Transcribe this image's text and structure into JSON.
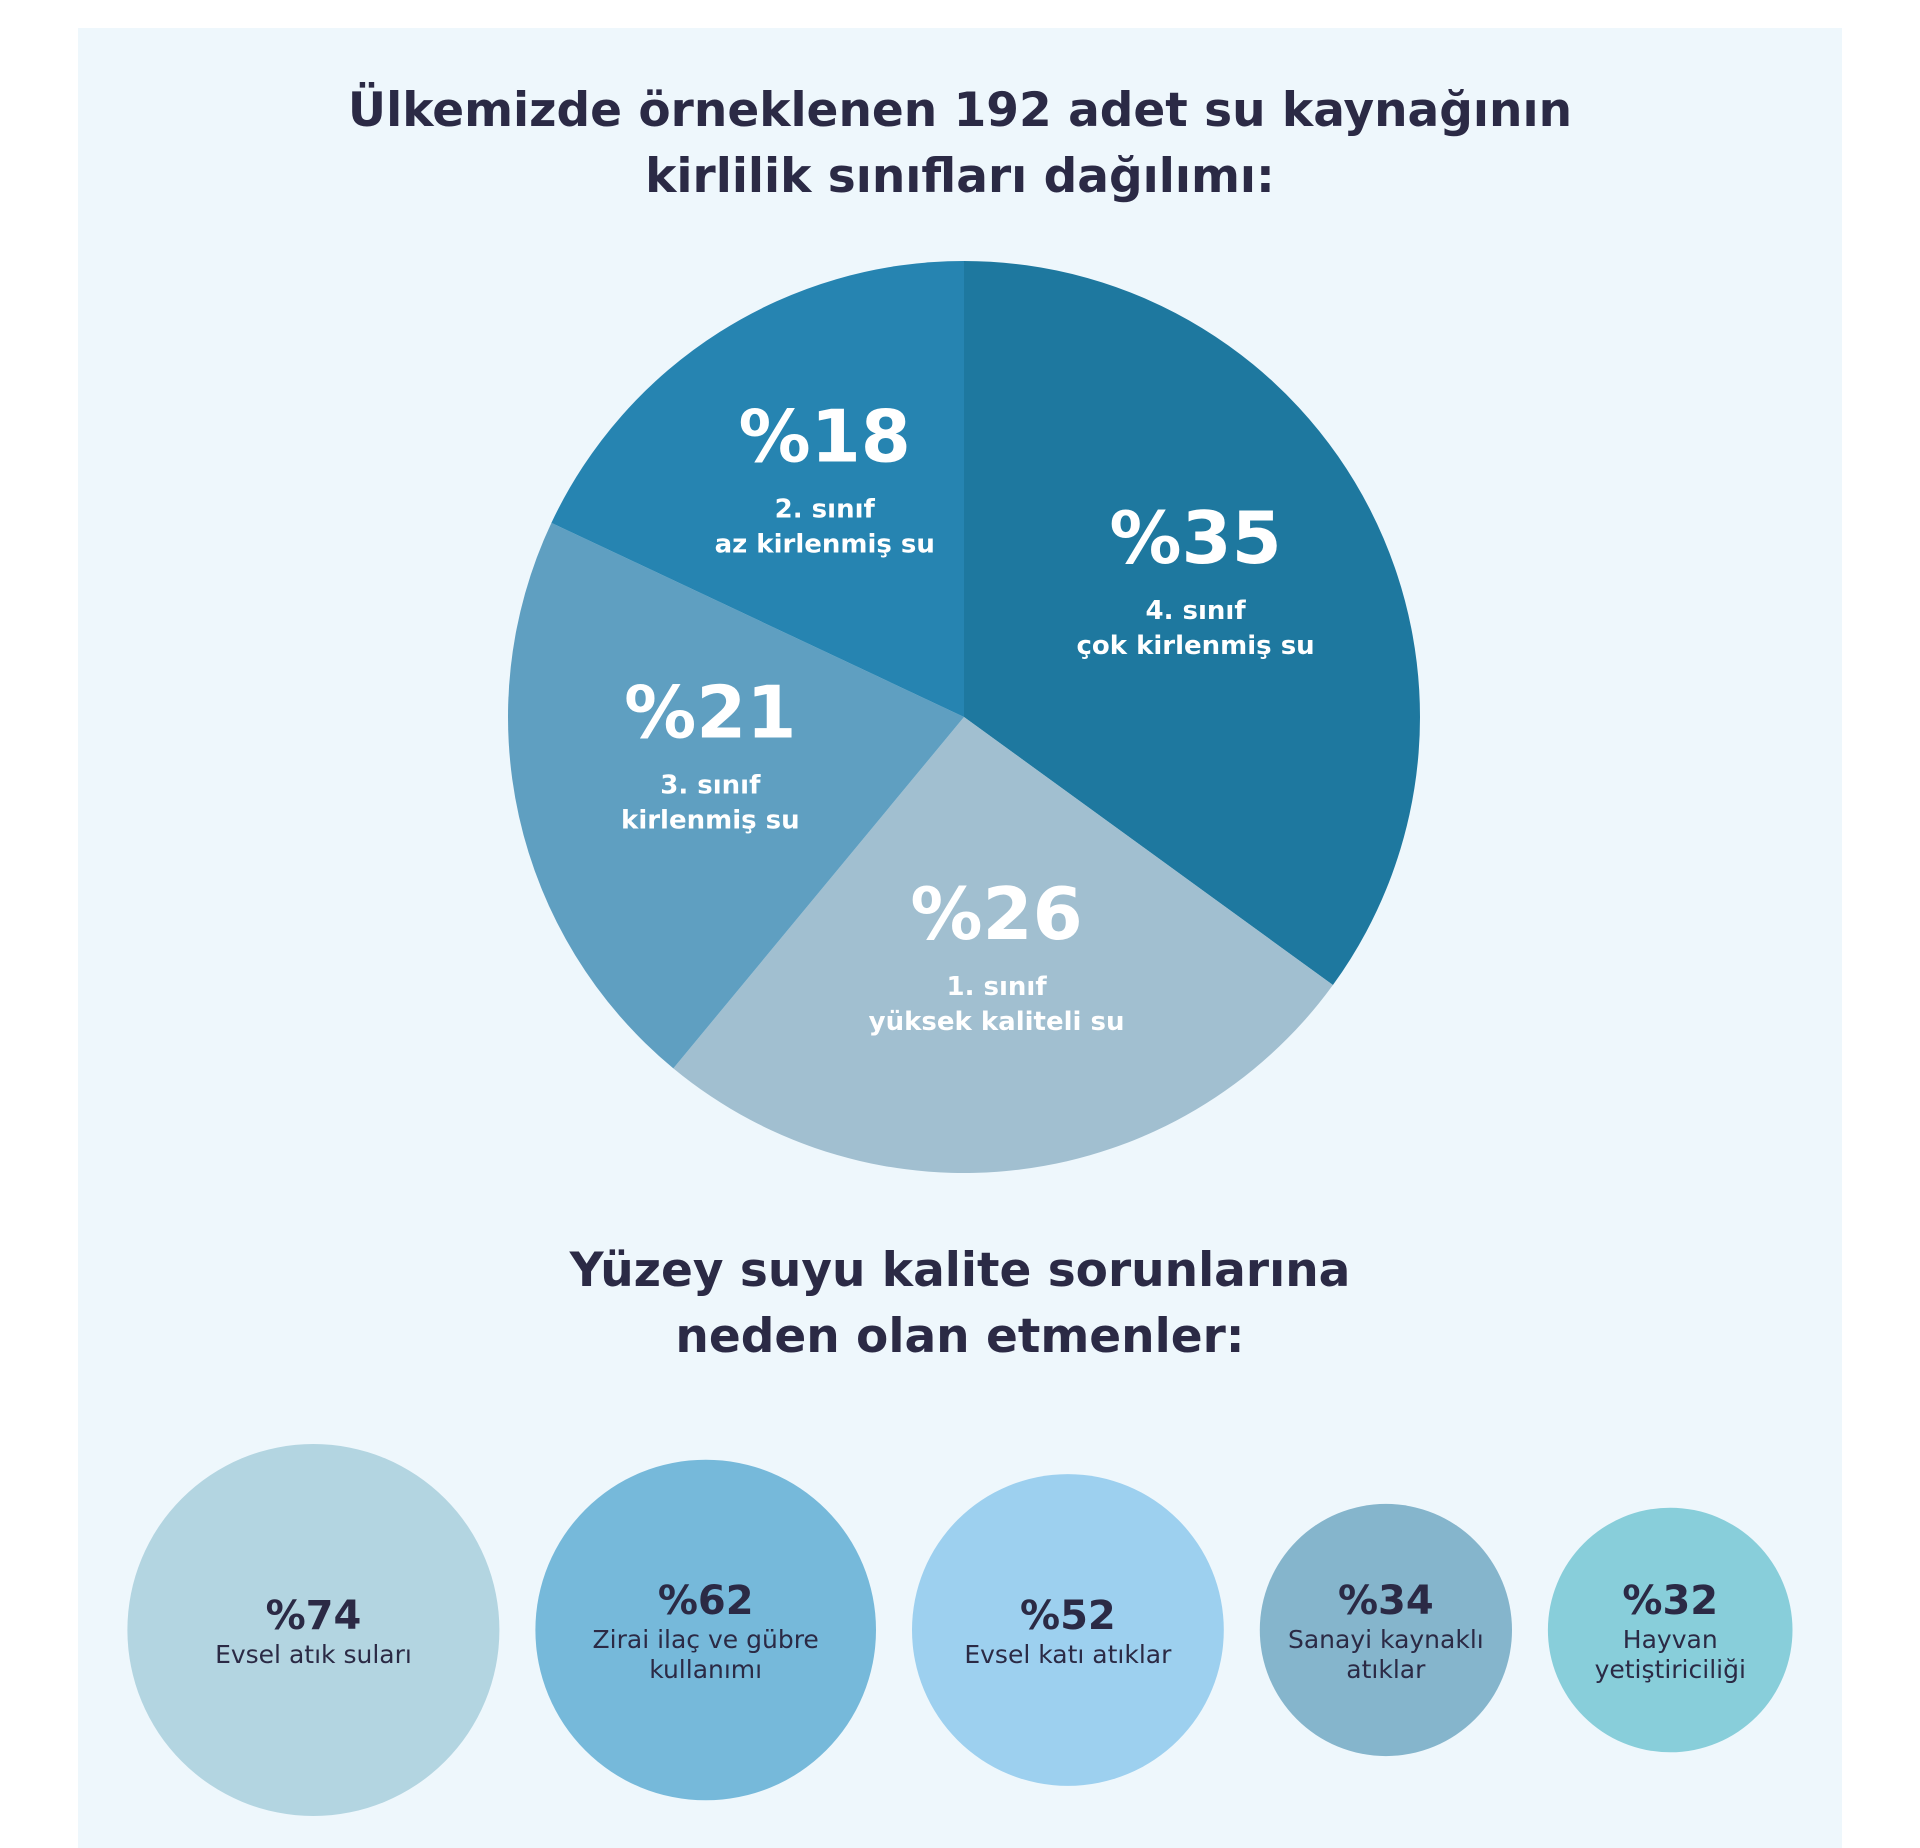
{
  "title_1": {
    "line1": "Ülkemizde örneklenen 192 adet su kaynağının",
    "line2": "kirlilik sınıfları dağılımı:"
  },
  "title_2": {
    "line1": "Yüzey suyu kalite sorunlarına",
    "line2": "neden olan etmenler:"
  },
  "colors": {
    "background": "#eef7fc",
    "title": "#2b2a45"
  },
  "chart_data": [
    {
      "type": "pie",
      "slices": [
        {
          "value": 35,
          "label": "%35",
          "class_label": "4. sınıf",
          "desc": "çok kirlenmiş su",
          "color": "#1e789f"
        },
        {
          "value": 26,
          "label": "%26",
          "class_label": "1. sınıf",
          "desc": "yüksek kaliteli su",
          "color": "#a1bfd0"
        },
        {
          "value": 21,
          "label": "%21",
          "class_label": "3. sınıf",
          "desc": "kirlenmiş su",
          "color": "#5f9fc1"
        },
        {
          "value": 18,
          "label": "%18",
          "class_label": "2. sınıf",
          "desc": "az kirlenmiş su",
          "color": "#2684b1"
        }
      ]
    },
    {
      "type": "bubble",
      "items": [
        {
          "value": 74,
          "label": "%74",
          "desc": [
            "Evsel atık suları"
          ],
          "color": "#b3d5e1"
        },
        {
          "value": 62,
          "label": "%62",
          "desc": [
            "Zirai ilaç ve gübre",
            "kullanımı"
          ],
          "color": "#76b9da"
        },
        {
          "value": 52,
          "label": "%52",
          "desc": [
            "Evsel katı atıklar"
          ],
          "color": "#9dd0ef"
        },
        {
          "value": 34,
          "label": "%34",
          "desc": [
            "Sanayi kaynaklı",
            "atıklar"
          ],
          "color": "#85b5cc"
        },
        {
          "value": 32,
          "label": "%32",
          "desc": [
            "Hayvan",
            "yetiştiriciliği"
          ],
          "color": "#88ceda"
        }
      ]
    }
  ]
}
